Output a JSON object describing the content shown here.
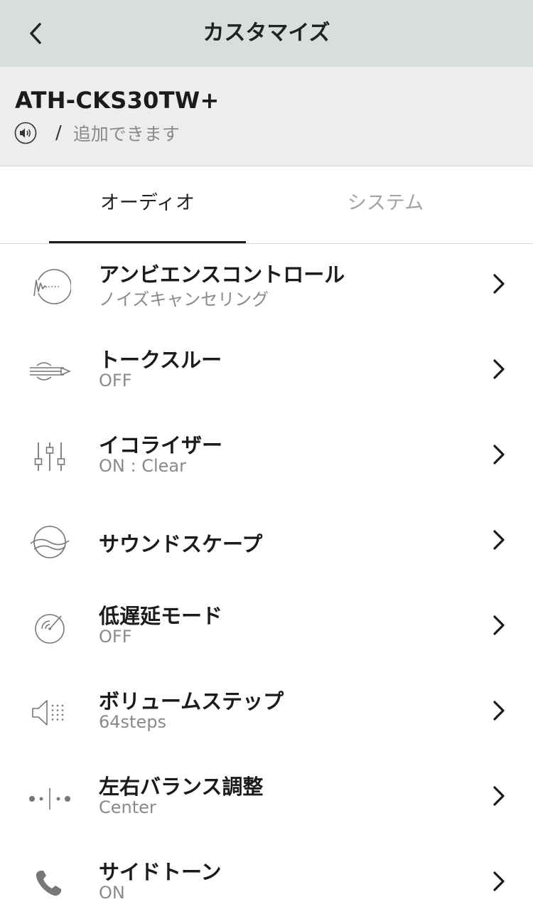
{
  "navbar": {
    "title": "カスタマイズ",
    "back_icon": "chevron-left-icon"
  },
  "device": {
    "name": "ATH-CKS30TW+",
    "speaker_icon": "speaker-icon",
    "slash": "/",
    "add_text": "追加できます"
  },
  "tabs": [
    {
      "label": "オーディオ",
      "active": true
    },
    {
      "label": "システム",
      "active": false
    }
  ],
  "items": [
    {
      "title": "アンビエンスコントロール",
      "subtitle": "ノイズキャンセリング",
      "icon": "ambient-control-icon"
    },
    {
      "title": "トークスルー",
      "subtitle": "OFF",
      "icon": "talk-through-icon"
    },
    {
      "title": "イコライザー",
      "subtitle": "ON : Clear",
      "icon": "equalizer-icon"
    },
    {
      "title": "サウンドスケープ",
      "subtitle": "",
      "icon": "soundscape-icon"
    },
    {
      "title": "低遅延モード",
      "subtitle": "OFF",
      "icon": "low-latency-icon"
    },
    {
      "title": "ボリュームステップ",
      "subtitle": "64steps",
      "icon": "volume-step-icon"
    },
    {
      "title": "左右バランス調整",
      "subtitle": "Center",
      "icon": "balance-icon"
    },
    {
      "title": "サイドトーン",
      "subtitle": "ON",
      "icon": "phone-icon"
    }
  ],
  "colors": {
    "navbar_bg": "#d8dddd",
    "header_bg": "#ededed",
    "text_primary": "#1b1b1b",
    "text_secondary": "#8a8a8a",
    "tab_inactive": "#a3a3a3",
    "icon_gray": "#777777"
  }
}
